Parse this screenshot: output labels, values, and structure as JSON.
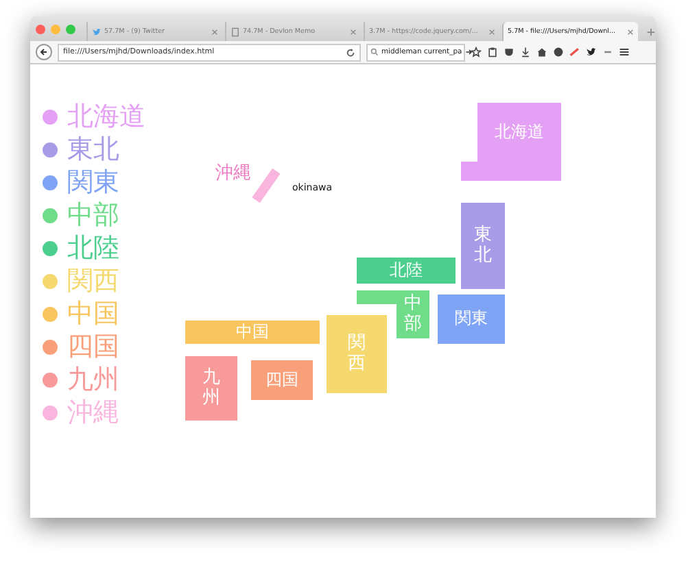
{
  "browser": {
    "tabs": [
      {
        "label": "57.7M - (9) Twitter",
        "selected": false
      },
      {
        "label": "74.7M - Devlon Memo",
        "selected": false
      },
      {
        "label": "3.7M - https://code.jquery.com/...",
        "selected": false
      },
      {
        "label": "5.7M - file:///Users/mjhd/Downl...",
        "selected": true
      }
    ],
    "url": "file:///Users/mjhd/Downloads/index.html",
    "search": "middleman current_pa"
  },
  "legend": [
    {
      "label": "北海道",
      "color": "#e3a0f5"
    },
    {
      "label": "東北",
      "color": "#a89ce8"
    },
    {
      "label": "関東",
      "color": "#7fa4f5"
    },
    {
      "label": "中部",
      "color": "#6fdc8a"
    },
    {
      "label": "北陸",
      "color": "#4ccf8e"
    },
    {
      "label": "関西",
      "color": "#f5d96e"
    },
    {
      "label": "中国",
      "color": "#f9c55e"
    },
    {
      "label": "四国",
      "color": "#f9a07a"
    },
    {
      "label": "九州",
      "color": "#f99a9a"
    },
    {
      "label": "沖縄",
      "color": "#f9b5de"
    }
  ],
  "map": {
    "blocks": [
      {
        "label": "北海道",
        "color": "#e3a0f5",
        "kind": "horizontal"
      },
      {
        "label": "東北",
        "color": "#a89ce8",
        "kind": "vertical"
      },
      {
        "label": "北陸",
        "color": "#4ccf8e",
        "kind": "horizontal"
      },
      {
        "label": "中部",
        "color": "#6fdc8a",
        "kind": "vertical"
      },
      {
        "label": "関東",
        "color": "#7fa4f5",
        "kind": "horizontal"
      },
      {
        "label": "関西",
        "color": "#f5d96e",
        "kind": "vertical"
      },
      {
        "label": "中国",
        "color": "#f9c55e",
        "kind": "horizontal"
      },
      {
        "label": "九州",
        "color": "#f99a9a",
        "kind": "vertical"
      },
      {
        "label": "四国",
        "color": "#f9a07a",
        "kind": "horizontal"
      }
    ],
    "okinawa": {
      "label": "沖縄",
      "caption": "okinawa"
    }
  }
}
